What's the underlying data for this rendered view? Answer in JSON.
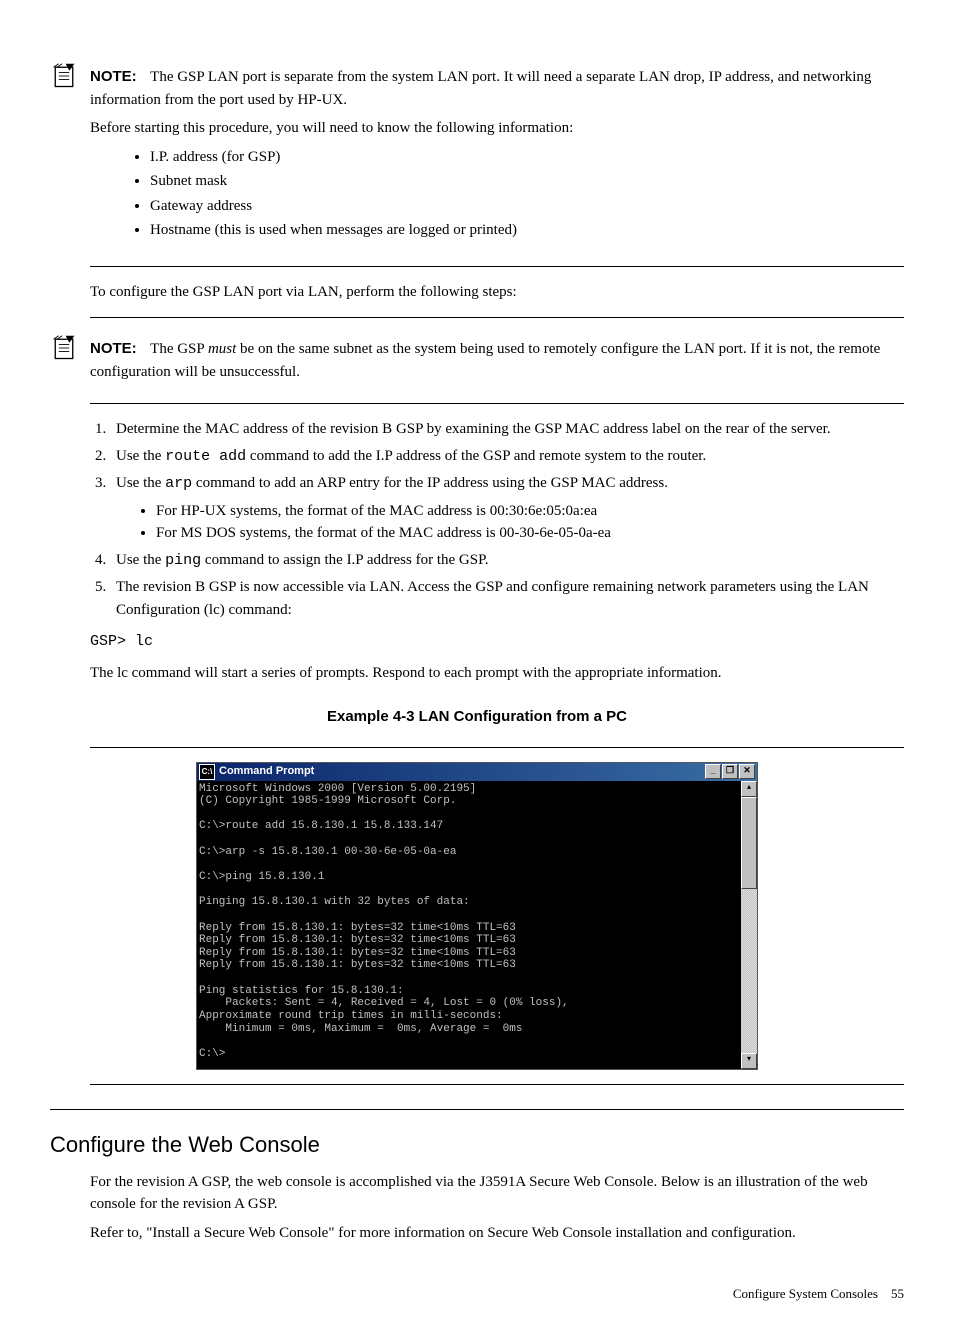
{
  "note1": {
    "label": "NOTE:",
    "text1": "The GSP LAN port is separate from the system LAN port. It will need a separate LAN drop, IP address, and networking information from the port used by HP-UX.",
    "text2": "Before starting this procedure, you will need to know the following information:",
    "bullets": [
      "I.P. address (for GSP)",
      "Subnet mask",
      "Gateway address",
      "Hostname (this is used when messages are logged or printed)"
    ]
  },
  "para_configure": "To configure the GSP LAN port via LAN, perform the following steps:",
  "note2": {
    "label": "NOTE:",
    "prefix": "The GSP ",
    "must": "must",
    "suffix": " be on the same subnet as the system being used to remotely configure the LAN port. If it is not, the remote configuration will be unsuccessful."
  },
  "steps": {
    "s1": "Determine the MAC address of the revision B GSP by examining the GSP MAC address label on the rear of the server.",
    "s2a": "Use the ",
    "s2code": "route add",
    "s2b": " command to add the I.P address of the GSP and remote system to the router.",
    "s3a": "Use the ",
    "s3code": "arp",
    "s3b": " command to add an ARP entry for the IP address using the GSP MAC address.",
    "s3sub1": "For HP-UX systems, the format of the MAC address is 00:30:6e:05:0a:ea",
    "s3sub2": "For MS DOS systems, the format of the MAC address is 00-30-6e-05-0a-ea",
    "s4a": "Use the ",
    "s4code": "ping",
    "s4b": " command to assign the I.P address for the GSP.",
    "s5": "The revision B GSP is now accessible via LAN. Access the GSP and configure remaining network parameters using the LAN Configuration (lc) command:"
  },
  "gsp_prompt": "GSP> lc",
  "lc_para": "The lc command will start a series of prompts. Respond to each prompt with the appropriate information.",
  "example_caption": "Example 4-3 LAN Configuration from a PC",
  "cmd": {
    "title": "Command Prompt",
    "min": "_",
    "max": "❐",
    "close": "✕",
    "up": "▴",
    "down": "▾",
    "body": "Microsoft Windows 2000 [Version 5.00.2195]\n(C) Copyright 1985-1999 Microsoft Corp.\n\nC:\\>route add 15.8.130.1 15.8.133.147\n\nC:\\>arp -s 15.8.130.1 00-30-6e-05-0a-ea\n\nC:\\>ping 15.8.130.1\n\nPinging 15.8.130.1 with 32 bytes of data:\n\nReply from 15.8.130.1: bytes=32 time<10ms TTL=63\nReply from 15.8.130.1: bytes=32 time<10ms TTL=63\nReply from 15.8.130.1: bytes=32 time<10ms TTL=63\nReply from 15.8.130.1: bytes=32 time<10ms TTL=63\n\nPing statistics for 15.8.130.1:\n    Packets: Sent = 4, Received = 4, Lost = 0 (0% loss),\nApproximate round trip times in milli-seconds:\n    Minimum = 0ms, Maximum =  0ms, Average =  0ms\n\nC:\\>"
  },
  "section_heading": "Configure the Web Console",
  "web1": "For the revision A GSP, the web console is accomplished via the J3591A Secure Web Console. Below is an illustration of the web console for the revision A GSP.",
  "web2": "Refer to, \"Install a Secure Web Console\" for more information on Secure Web Console installation and configuration.",
  "footer_text": "Configure System Consoles",
  "footer_page": "55"
}
